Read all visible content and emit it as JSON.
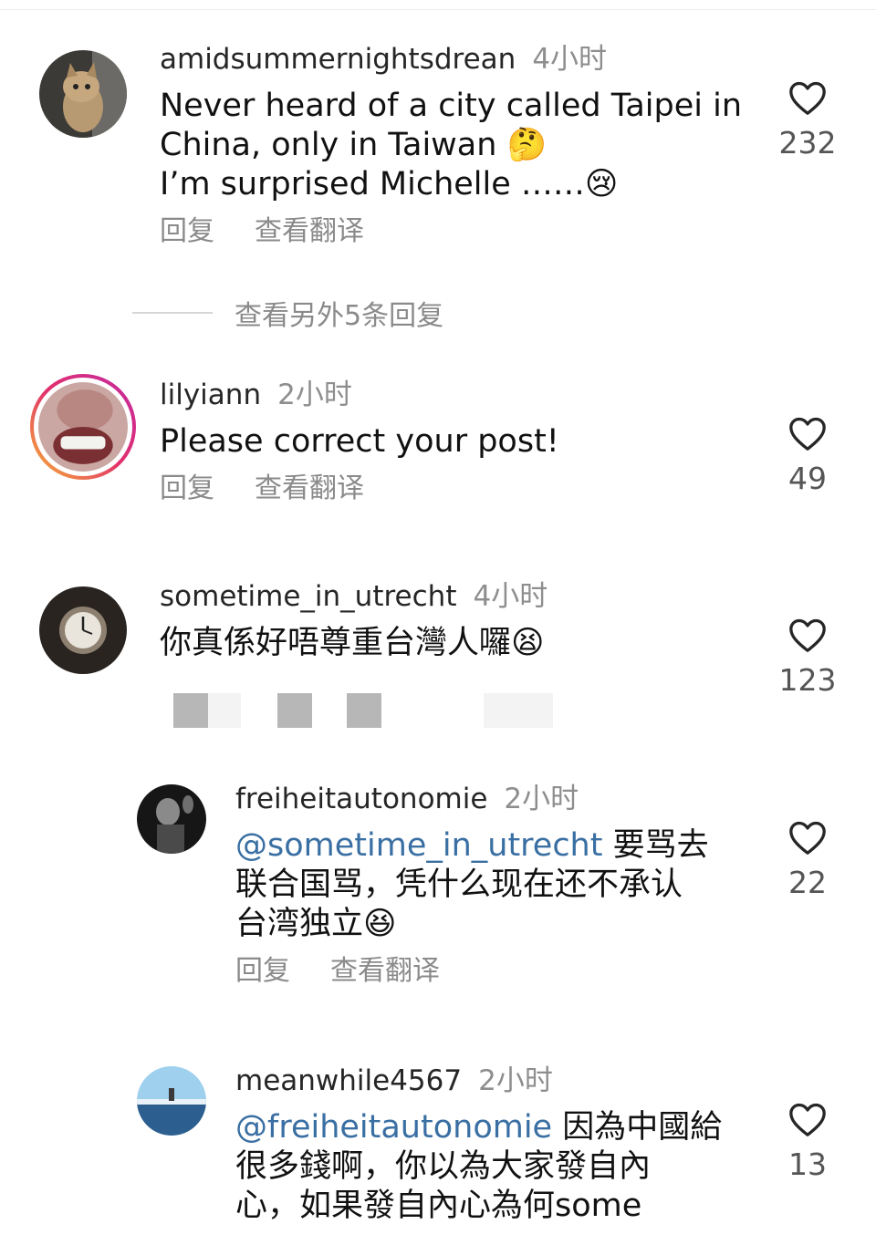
{
  "comments": [
    {
      "username": "amidsummernightsdrean",
      "time": "4小时",
      "text_lines": [
        "Never heard of a city called Taipei in",
        "China, only in Taiwan 🤔",
        "I’m surprised Michelle ……😢"
      ],
      "reply": "回复",
      "translate": "查看翻译",
      "likes": "232",
      "avatar": "cat-photo"
    },
    {
      "username": "lilyiann",
      "time": "2小时",
      "text": "Please correct your post!",
      "reply": "回复",
      "translate": "查看翻译",
      "likes": "49",
      "avatar": "face-closeup-with-story-ring"
    },
    {
      "username": "sometime_in_utrecht",
      "time": "4小时",
      "text": "你真係好唔尊重台灣人囉😫",
      "likes": "123",
      "avatar": "clock-photo"
    },
    {
      "username": "freiheitautonomie",
      "time": "2小时",
      "mention": "@sometime_in_utrecht",
      "text_after_mention": " 要骂去",
      "text_lines": [
        "联合国骂，凭什么现在还不承认",
        "台湾独立😆"
      ],
      "reply": "回复",
      "translate": "查看翻译",
      "likes": "22",
      "avatar": "person-bw-photo"
    },
    {
      "username": "meanwhile4567",
      "time": "2小时",
      "mention": "@freiheitautonomie",
      "text_after_mention": " 因為中國給",
      "text_lines": [
        "很多錢啊，你以為大家發自內",
        "心，如果發自內心為何some"
      ],
      "likes": "13",
      "avatar": "sea-landscape-photo"
    }
  ],
  "more_replies": "查看另外5条回复",
  "icons": {
    "like": "heart-outline-icon"
  },
  "colors": {
    "mention": "#3a6fa3",
    "muted": "#8a8a8a",
    "story_ring_start": "#f7b733",
    "story_ring_end": "#c32aa3"
  }
}
